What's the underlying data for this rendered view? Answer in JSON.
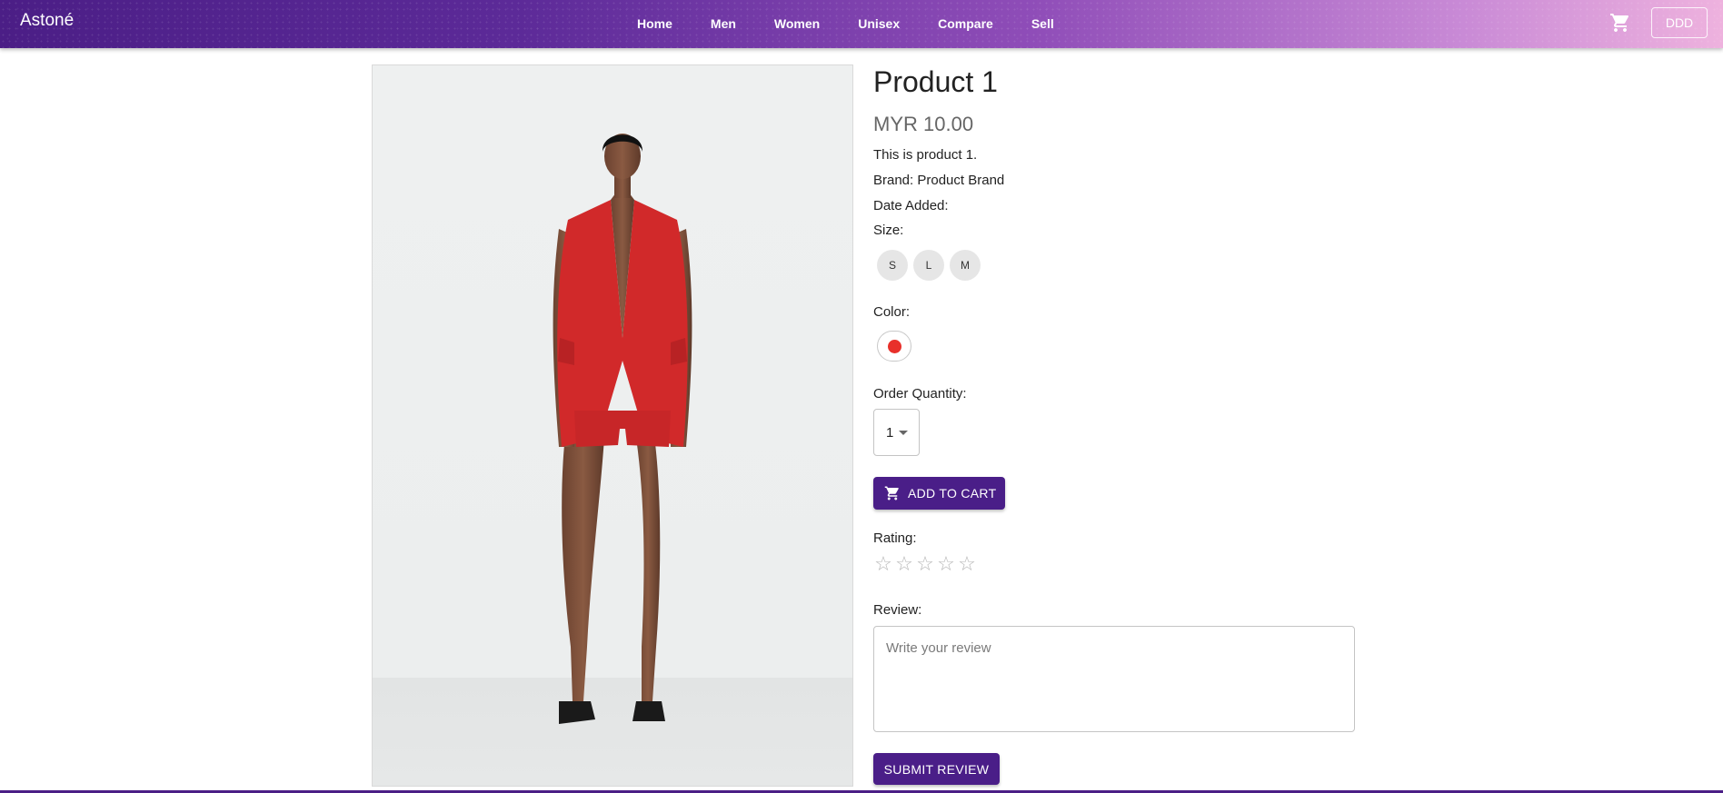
{
  "navbar": {
    "brand": "Astoné",
    "links": [
      "Home",
      "Men",
      "Women",
      "Unisex",
      "Compare",
      "Sell"
    ],
    "cart_icon": "shopping-cart-icon",
    "user_label": "DDD"
  },
  "product": {
    "title": "Product 1",
    "price": "MYR 10.00",
    "description": "This is product 1.",
    "brand_line": "Brand: Product Brand",
    "date_added_label": "Date Added:",
    "size_label": "Size:",
    "sizes": [
      "S",
      "L",
      "M"
    ],
    "color_label": "Color:",
    "color_value": "#e8302a",
    "quantity_label": "Order Quantity:",
    "quantity_value": "1",
    "add_to_cart_label": "ADD TO CART"
  },
  "rating": {
    "label": "Rating:",
    "stars_filled": 0,
    "stars_total": 5
  },
  "review": {
    "label": "Review:",
    "placeholder": "Write your review",
    "submit_label": "SUBMIT REVIEW"
  },
  "colors": {
    "accent": "#4b1e86",
    "button": "#4a1e88"
  }
}
